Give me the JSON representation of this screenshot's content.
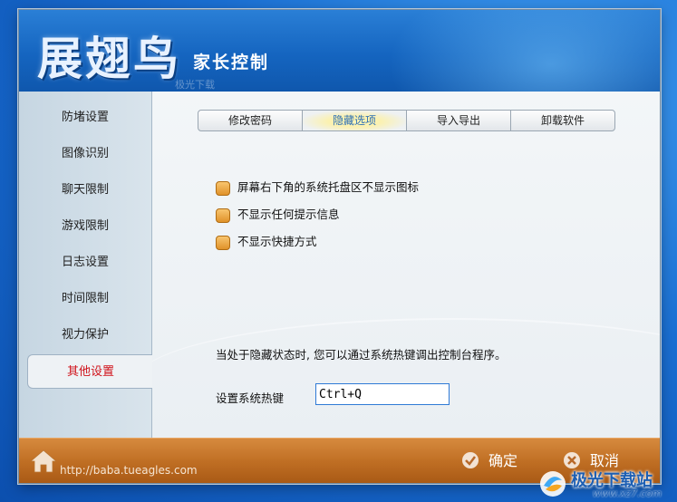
{
  "app": {
    "logo_title": "展翅鸟",
    "logo_subtitle": "家长控制",
    "header_watermark": "极光下载"
  },
  "sidebar": {
    "items": [
      {
        "label": "防堵设置"
      },
      {
        "label": "图像识别"
      },
      {
        "label": "聊天限制"
      },
      {
        "label": "游戏限制"
      },
      {
        "label": "日志设置"
      },
      {
        "label": "时间限制"
      },
      {
        "label": "视力保护"
      },
      {
        "label": "其他设置"
      }
    ],
    "active_index": 7
  },
  "tabs": [
    {
      "label": "修改密码"
    },
    {
      "label": "隐藏选项"
    },
    {
      "label": "导入导出"
    },
    {
      "label": "卸载软件"
    }
  ],
  "options": [
    {
      "label": "屏幕右下角的系统托盘区不显示图标",
      "checked": false
    },
    {
      "label": "不显示任何提示信息",
      "checked": false
    },
    {
      "label": "不显示快捷方式",
      "checked": false
    }
  ],
  "info_text": "当处于隐藏状态时, 您可以通过系统热键调出控制台程序。",
  "hotkey": {
    "label": "设置系统热键",
    "value": "Ctrl+Q"
  },
  "footer": {
    "url": "http://baba.tueagles.com",
    "confirm_label": "确定",
    "cancel_label": "取消"
  },
  "watermark": {
    "name": "极光下载站",
    "url": "www.xz7.com"
  }
}
